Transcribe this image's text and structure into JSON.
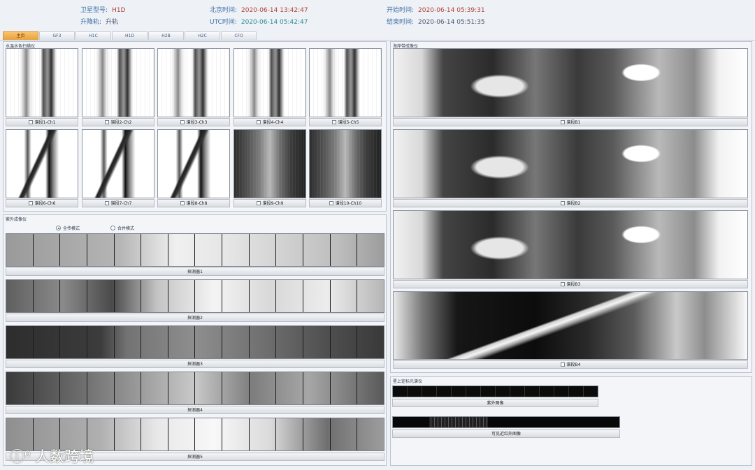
{
  "header": {
    "satellite_label": "卫星型号:",
    "satellite_value": "H1D",
    "orbit_label": "升降轨:",
    "orbit_value": "升轨",
    "beijing_label": "北京时间:",
    "beijing_value": "2020-06-14 13:42:47",
    "utc_label": "UTC时间:",
    "utc_value": "2020-06-14 05:42:47",
    "start_label": "开始时间:",
    "start_value": "2020-06-14 05:39:31",
    "end_label": "结束时间:",
    "end_value": "2020-06-14 05:51:35"
  },
  "tabs": [
    {
      "label": "主页",
      "active": true
    },
    {
      "label": "GF3",
      "active": false
    },
    {
      "label": "H1C",
      "active": false
    },
    {
      "label": "H1D",
      "active": false
    },
    {
      "label": "H2B",
      "active": false
    },
    {
      "label": "H2C",
      "active": false
    },
    {
      "label": "CFO",
      "active": false
    }
  ],
  "water_color": {
    "title": "水温水色扫描仪",
    "channels": [
      "谱段1-Ch1",
      "谱段2-Ch2",
      "谱段3-Ch3",
      "谱段4-Ch4",
      "谱段5-Ch5",
      "谱段6-Ch6",
      "谱段7-Ch7",
      "谱段8-Ch8",
      "谱段9-Ch9",
      "谱段10-Ch10"
    ]
  },
  "uv_imager": {
    "title": "紫外成像仪",
    "mode_full": "全传模式",
    "mode_merge": "合并模式",
    "selected_mode": "全传模式",
    "detectors": [
      "探测器1",
      "探测器2",
      "探测器3",
      "探测器4",
      "探测器5"
    ]
  },
  "ocean_imager": {
    "title": "海岸带成像仪",
    "bands": [
      "谱段B1",
      "谱段B2",
      "谱段B3",
      "谱段B4"
    ]
  },
  "spectrometer": {
    "title": "星上定标光谱仪",
    "uv_label": "紫外图像",
    "vis_label": "可见近红外图像"
  },
  "watermark": "人数跨境"
}
